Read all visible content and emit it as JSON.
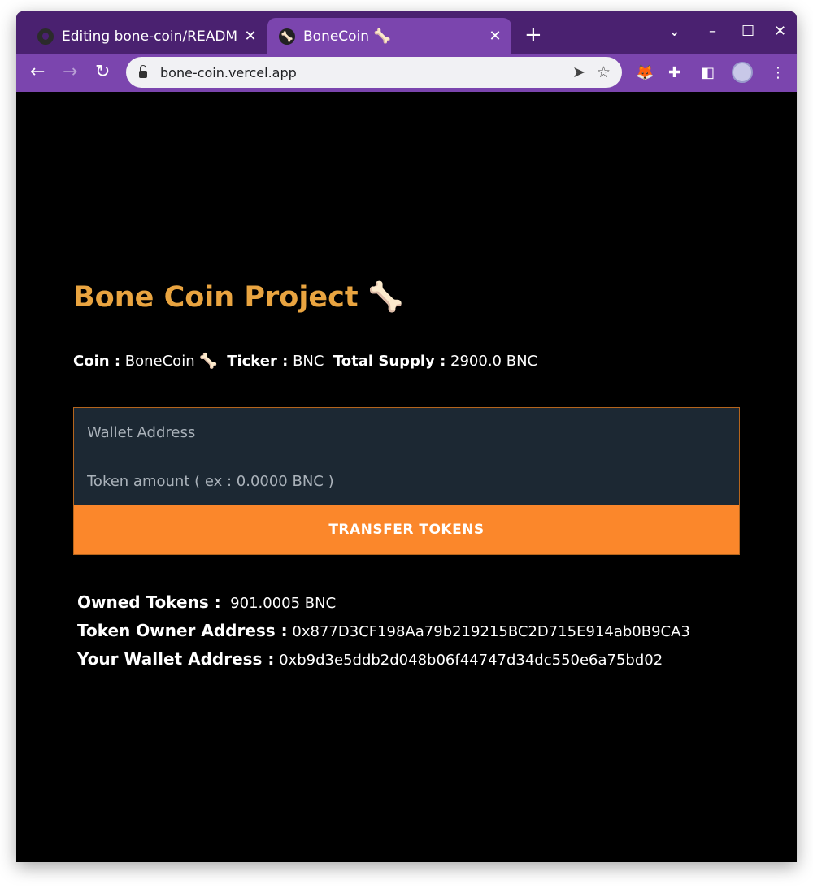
{
  "browser": {
    "tabs": [
      {
        "title": "Editing bone-coin/READM",
        "favicon": "github-icon",
        "active": false
      },
      {
        "title": "BoneCoin 🦴",
        "favicon": "bone-icon",
        "active": true
      }
    ],
    "url": "bone-coin.vercel.app",
    "accent": "#7b45ae",
    "tabbar_color": "#4a2170"
  },
  "page": {
    "heading": "Bone Coin Project 🦴",
    "heading_color": "#e9a440",
    "coin_label": "Coin :",
    "coin_value": "BoneCoin 🦴",
    "ticker_label": "Ticker :",
    "ticker_value": "BNC",
    "supply_label": "Total Supply :",
    "supply_value": "2900.0 BNC",
    "form": {
      "wallet_placeholder": "Wallet Address",
      "amount_placeholder": "Token amount ( ex : 0.0000 BNC )",
      "button_label": "TRANSFER TOKENS",
      "button_color": "#fb872b"
    },
    "stats": {
      "owned_label": "Owned Tokens :",
      "owned_value": "901.0005 BNC",
      "owner_label": "Token Owner Address :",
      "owner_value": "0x877D3CF198Aa79b219215BC2D715E914ab0B9CA3",
      "wallet_label": "Your Wallet Address :",
      "wallet_value": "0xb9d3e5ddb2d048b06f44747d34dc550e6a75bd02"
    }
  }
}
